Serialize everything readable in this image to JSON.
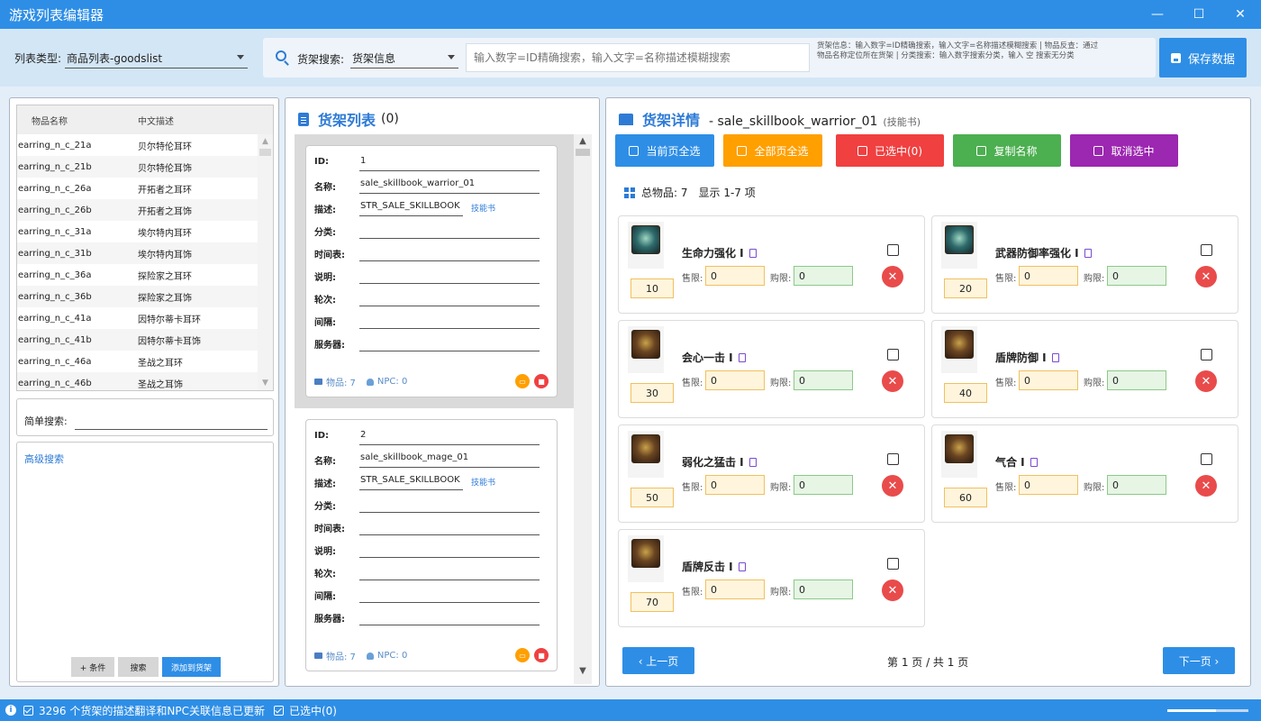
{
  "window": {
    "title": "游戏列表编辑器",
    "minimize": "—",
    "maximize": "☐",
    "close": "✕"
  },
  "toolbar": {
    "list_type_label": "列表类型:",
    "list_type_value": "商品列表-goodslist",
    "search_label": "货架搜索:",
    "search_mode": "货架信息",
    "search_placeholder": "输入数字=ID精确搜索，输入文字=名称描述模糊搜索",
    "hint": "货架信息：输入数字=ID精确搜索，输入文字=名称描述模糊搜索 | 物品反查：通过物品名称定位所在货架 | 分类搜索：输入数字搜索分类，输入 空 搜索无分类",
    "save_label": "保存数据"
  },
  "left": {
    "columns": [
      "物品名称",
      "中文描述"
    ],
    "rows": [
      [
        "earring_n_c_21a",
        "贝尔特伦耳环"
      ],
      [
        "earring_n_c_21b",
        "贝尔特伦耳饰"
      ],
      [
        "earring_n_c_26a",
        "开拓者之耳环"
      ],
      [
        "earring_n_c_26b",
        "开拓者之耳饰"
      ],
      [
        "earring_n_c_31a",
        "埃尔特内耳环"
      ],
      [
        "earring_n_c_31b",
        "埃尔特内耳饰"
      ],
      [
        "earring_n_c_36a",
        "探险家之耳环"
      ],
      [
        "earring_n_c_36b",
        "探险家之耳饰"
      ],
      [
        "earring_n_c_41a",
        "因特尔蒂卡耳环"
      ],
      [
        "earring_n_c_41b",
        "因特尔蒂卡耳饰"
      ],
      [
        "earring_n_c_46a",
        "圣战之耳环"
      ],
      [
        "earring_n_c_46b",
        "圣战之耳饰"
      ]
    ],
    "simple_search_label": "简单搜索:",
    "advanced_search_label": "高级搜索",
    "add_condition": "+ 条件",
    "search_btn": "搜索",
    "add_to_shelf": "添加到货架"
  },
  "middle": {
    "title": "货架列表",
    "count": "(0)",
    "field_labels": {
      "id": "ID:",
      "name": "名称:",
      "desc": "描述:",
      "category": "分类:",
      "schedule": "时间表:",
      "note": "说明:",
      "round": "轮次:",
      "interval": "间隔:",
      "server": "服务器:"
    },
    "shelves": [
      {
        "id": "1",
        "name": "sale_skillbook_warrior_01",
        "desc": "STR_SALE_SKILLBOOK",
        "tag": "技能书",
        "items": "物品: 7",
        "npc": "NPC: 0"
      },
      {
        "id": "2",
        "name": "sale_skillbook_mage_01",
        "desc": "STR_SALE_SKILLBOOK",
        "tag": "技能书",
        "items": "物品: 7",
        "npc": "NPC: 0"
      }
    ]
  },
  "right": {
    "title": "货架详情",
    "shelf_name": "- sale_skillbook_warrior_01",
    "shelf_type": "(技能书)",
    "buttons": {
      "select_page": "当前页全选",
      "select_all": "全部页全选",
      "delete_selected": "已选中(0)",
      "copy_name": "复制名称",
      "deselect": "取消选中"
    },
    "total_items": "总物品: 7",
    "display_range": "显示 1-7 项",
    "sell_label": "售限:",
    "buy_label": "购限:",
    "items": [
      {
        "name": "生命力强化 I",
        "level": "10",
        "sell": "0",
        "buy": "0",
        "icon": "skillbook-green-icon"
      },
      {
        "name": "武器防御率强化 I",
        "level": "20",
        "sell": "0",
        "buy": "0",
        "icon": "skillbook-green-icon"
      },
      {
        "name": "会心一击 I",
        "level": "30",
        "sell": "0",
        "buy": "0",
        "icon": "skillbook-brown-icon"
      },
      {
        "name": "盾牌防御 I",
        "level": "40",
        "sell": "0",
        "buy": "0",
        "icon": "skillbook-brown-icon"
      },
      {
        "name": "弱化之猛击 I",
        "level": "50",
        "sell": "0",
        "buy": "0",
        "icon": "skillbook-brown-icon"
      },
      {
        "name": "气合 I",
        "level": "60",
        "sell": "0",
        "buy": "0",
        "icon": "skillbook-brown-icon"
      },
      {
        "name": "盾牌反击 I",
        "level": "70",
        "sell": "0",
        "buy": "0",
        "icon": "skillbook-brown-icon"
      }
    ],
    "prev_page": "‹ 上一页",
    "next_page": "下一页 ›",
    "page_info": "第 1 页 / 共 1 页"
  },
  "status": {
    "message": "3296 个货架的描述翻译和NPC关联信息已更新",
    "selected": "已选中(0)"
  },
  "colors": {
    "primary": "#2e8ee6",
    "orange": "#ff9f00",
    "red": "#f04040",
    "green": "#4caf50",
    "purple": "#9c27b0"
  }
}
